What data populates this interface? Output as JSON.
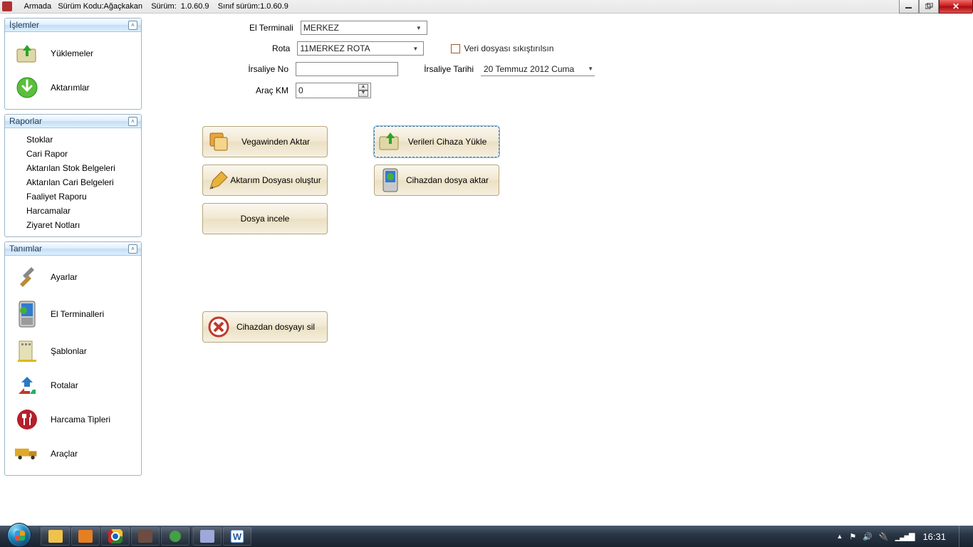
{
  "titlebar": {
    "app": "Armada",
    "version_code_label": "Sürüm Kodu:",
    "version_code": "Ağaçkakan",
    "version_label": "Sürüm:",
    "version": "1.0.60.9",
    "class_version_label": "Sınıf sürüm:",
    "class_version": "1.0.60.9"
  },
  "sidebar": {
    "panels": [
      {
        "title": "İşlemler",
        "items": [
          {
            "label": "Yüklemeler"
          },
          {
            "label": "Aktarımlar"
          }
        ]
      },
      {
        "title": "Raporlar",
        "links": [
          "Stoklar",
          "Cari Rapor",
          "Aktarılan Stok Belgeleri",
          "Aktarılan Cari Belgeleri",
          "Faaliyet Raporu",
          "Harcamalar",
          "Ziyaret Notları"
        ]
      },
      {
        "title": "Tanımlar",
        "items": [
          {
            "label": "Ayarlar"
          },
          {
            "label": "El Terminalleri"
          },
          {
            "label": "Şablonlar"
          },
          {
            "label": "Rotalar"
          },
          {
            "label": "Harcama Tipleri"
          },
          {
            "label": "Araçlar"
          }
        ]
      }
    ]
  },
  "form": {
    "terminal_label": "El Terminali",
    "terminal_value": "MERKEZ",
    "rota_label": "Rota",
    "rota_value": "11MERKEZ ROTA",
    "compress_label": "Veri dosyası sıkıştırılsın",
    "irsaliye_no_label": "İrsaliye No",
    "irsaliye_no_value": "",
    "irsaliye_tarihi_label": "İrsaliye Tarihi",
    "irsaliye_tarihi_value": "20 Temmuz 2012   Cuma",
    "arac_km_label": "Araç KM",
    "arac_km_value": "0",
    "buttons": {
      "vegawinden_aktar": "Vegawinden Aktar",
      "verileri_cihaza_yukle": "Verileri Cihaza Yükle",
      "aktarim_dosyasi_olustur": "Aktarım Dosyası oluştur",
      "cihazdan_dosya_aktar": "Cihazdan dosya aktar",
      "dosya_incele": "Dosya incele",
      "cihazdan_dosyayi_sil": "Cihazdan dosyayı sil"
    }
  },
  "taskbar": {
    "time": "16:31"
  }
}
